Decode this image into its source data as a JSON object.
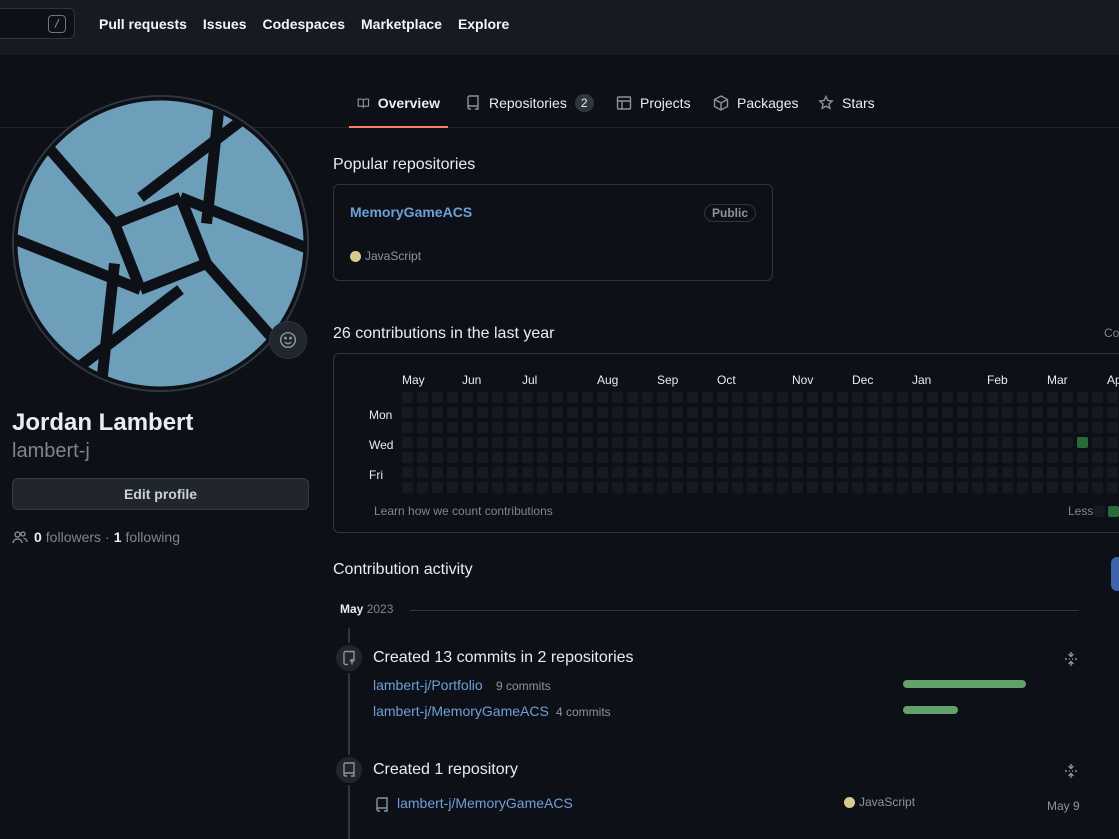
{
  "header": {
    "search_shortcut": "/",
    "nav": [
      "Pull requests",
      "Issues",
      "Codespaces",
      "Marketplace",
      "Explore"
    ]
  },
  "tabs": [
    {
      "label": "Overview",
      "icon": "book-icon",
      "selected": true
    },
    {
      "label": "Repositories",
      "icon": "repo-icon",
      "count": "2"
    },
    {
      "label": "Projects",
      "icon": "table-icon"
    },
    {
      "label": "Packages",
      "icon": "package-icon"
    },
    {
      "label": "Stars",
      "icon": "star-icon"
    }
  ],
  "profile": {
    "full_name": "Jordan Lambert",
    "username": "lambert-j",
    "edit_label": "Edit profile",
    "followers_count": "0",
    "followers_label": "followers",
    "separator": "·",
    "following_count": "1",
    "following_label": "following",
    "avatar_color": "#6e9fba"
  },
  "popular": {
    "title": "Popular repositories",
    "repos": [
      {
        "name": "MemoryGameACS",
        "visibility": "Public",
        "language": "JavaScript",
        "language_color": "#d9cb8e"
      }
    ]
  },
  "contributions": {
    "title": "26 contributions in the last year",
    "settings_cut": "Co",
    "months": [
      "May",
      "Jun",
      "Jul",
      "Aug",
      "Sep",
      "Oct",
      "Nov",
      "Dec",
      "Jan",
      "Feb",
      "Mar",
      "Ap"
    ],
    "days": [
      "Mon",
      "Wed",
      "Fri"
    ],
    "learn_label": "Learn how we count contributions",
    "less_label": "Less"
  },
  "activity": {
    "title": "Contribution activity",
    "month": "May",
    "year": "2023",
    "items": [
      {
        "heading": "Created 13 commits in 2 repositories",
        "repos": [
          {
            "name": "lambert-j/Portfolio",
            "count": "9 commits",
            "fraction": 0.69
          },
          {
            "name": "lambert-j/MemoryGameACS",
            "count": "4 commits",
            "fraction": 0.31
          }
        ]
      },
      {
        "heading": "Created 1 repository",
        "repo": "lambert-j/MemoryGameACS",
        "language": "JavaScript",
        "date": "May 9"
      }
    ]
  }
}
